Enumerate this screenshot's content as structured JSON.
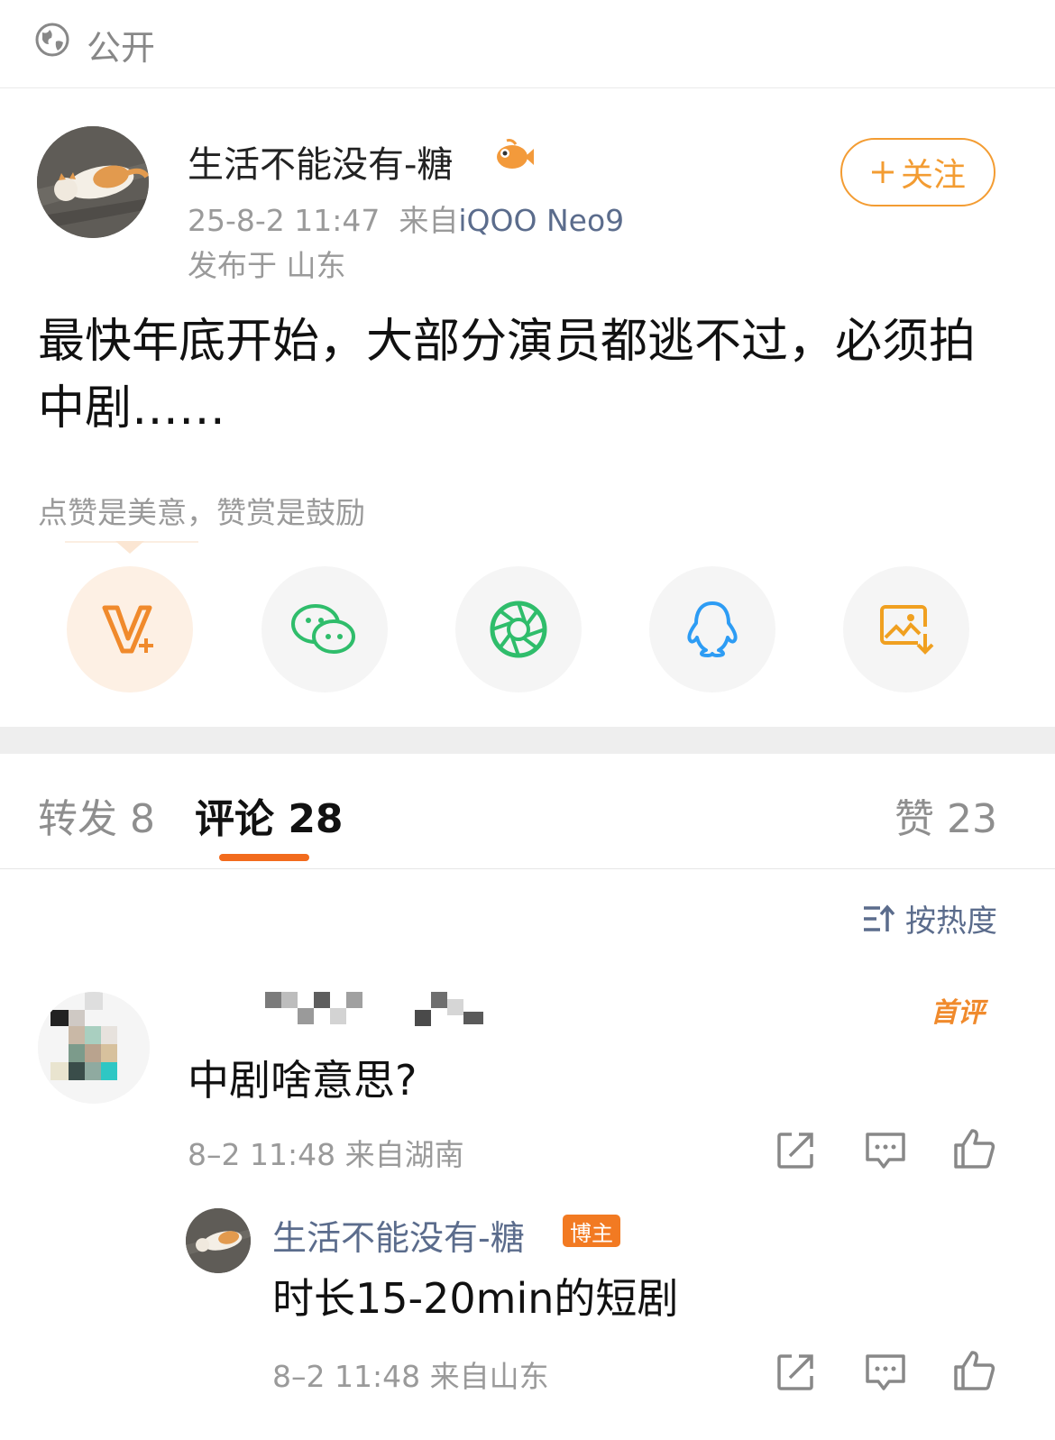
{
  "visibility": {
    "label": "公开",
    "icon": "globe-icon"
  },
  "post": {
    "author": "生活不能没有-糖",
    "timestamp": "25-8-2 11:47",
    "source_prefix": "来自",
    "device": "iQOO Neo9",
    "location": "发布于 山东",
    "follow_label": "关注",
    "text": "最快年底开始，大部分演员都逃不过，必须拍中剧……",
    "reward_tip": "点赞是美意，赞赏是鼓励"
  },
  "share": {
    "items": [
      {
        "icon": "vplus-icon",
        "color": "#f08a2c"
      },
      {
        "icon": "wechat-icon",
        "color": "#2fbd6b"
      },
      {
        "icon": "moments-icon",
        "color": "#2fbd6b"
      },
      {
        "icon": "qq-icon",
        "color": "#2d9cf4"
      },
      {
        "icon": "save-image-icon",
        "color": "#f0a020"
      }
    ]
  },
  "tabs": {
    "repost": "转发 8",
    "comment": "评论 28",
    "like": "赞 23"
  },
  "sort": {
    "label": "按热度"
  },
  "comments": [
    {
      "badge": "首评",
      "text": "中剧啥意思?",
      "meta": "8–2 11:48  来自湖南",
      "reply": {
        "author": "生活不能没有-糖",
        "badge": "博主",
        "text": "时长15-20min的短剧",
        "meta": "8–2 11:48  来自山东"
      }
    }
  ],
  "colors": {
    "accent": "#f39c32",
    "tab_underline": "#f26b1d",
    "link_blue": "#5b6c8c",
    "muted": "#9a9a9a"
  }
}
